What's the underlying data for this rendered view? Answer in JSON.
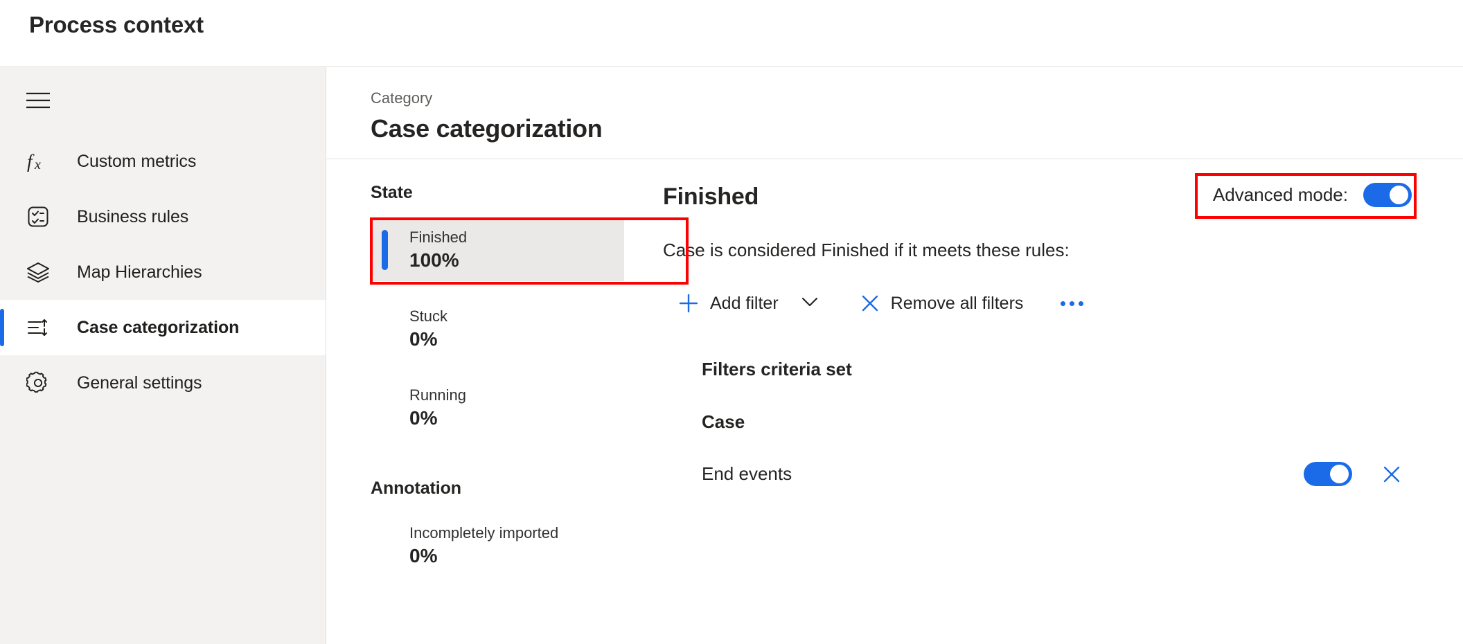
{
  "window": {
    "title": "Process context"
  },
  "sidebar": {
    "menu_icon": "hamburger-icon",
    "items": [
      {
        "label": "Custom metrics",
        "icon": "function-fx-icon",
        "selected": false
      },
      {
        "label": "Business rules",
        "icon": "checklist-box-icon",
        "selected": false
      },
      {
        "label": "Map Hierarchies",
        "icon": "layers-stack-icon",
        "selected": false
      },
      {
        "label": "Case categorization",
        "icon": "sort-lines-arrows-icon",
        "selected": true
      },
      {
        "label": "General settings",
        "icon": "gear-icon",
        "selected": false
      }
    ]
  },
  "header": {
    "eyebrow": "Category",
    "title": "Case categorization"
  },
  "states_panel": {
    "heading": "State",
    "items": [
      {
        "label": "Finished",
        "value": "100%",
        "active": true
      },
      {
        "label": "Stuck",
        "value": "0%",
        "active": false
      },
      {
        "label": "Running",
        "value": "0%",
        "active": false
      }
    ]
  },
  "annotation_panel": {
    "heading": "Annotation",
    "items": [
      {
        "label": "Incompletely imported",
        "value": "0%",
        "active": false
      }
    ]
  },
  "rules_panel": {
    "title": "Finished",
    "advanced_mode_label": "Advanced mode:",
    "advanced_mode_on": true,
    "description": "Case is considered Finished if it meets these rules:",
    "toolbar": {
      "add_filter_label": "Add filter",
      "add_filter_icon": "plus-icon",
      "add_filter_chevron_icon": "chevron-down-icon",
      "remove_all_label": "Remove all filters",
      "remove_all_icon": "close-x-icon",
      "more_icon": "ellipsis-icon"
    },
    "criteria_title": "Filters criteria set",
    "criteria_group": "Case",
    "filters": [
      {
        "label": "End events",
        "enabled": true,
        "remove_icon": "close-x-icon"
      }
    ]
  },
  "colors": {
    "accent_blue": "#1b6ae8",
    "annotation_red": "#ff0000",
    "sidebar_bg": "#f3f2f1",
    "card_bg": "#ebe9e7",
    "text_primary": "#252423",
    "text_secondary": "#605e5c"
  }
}
